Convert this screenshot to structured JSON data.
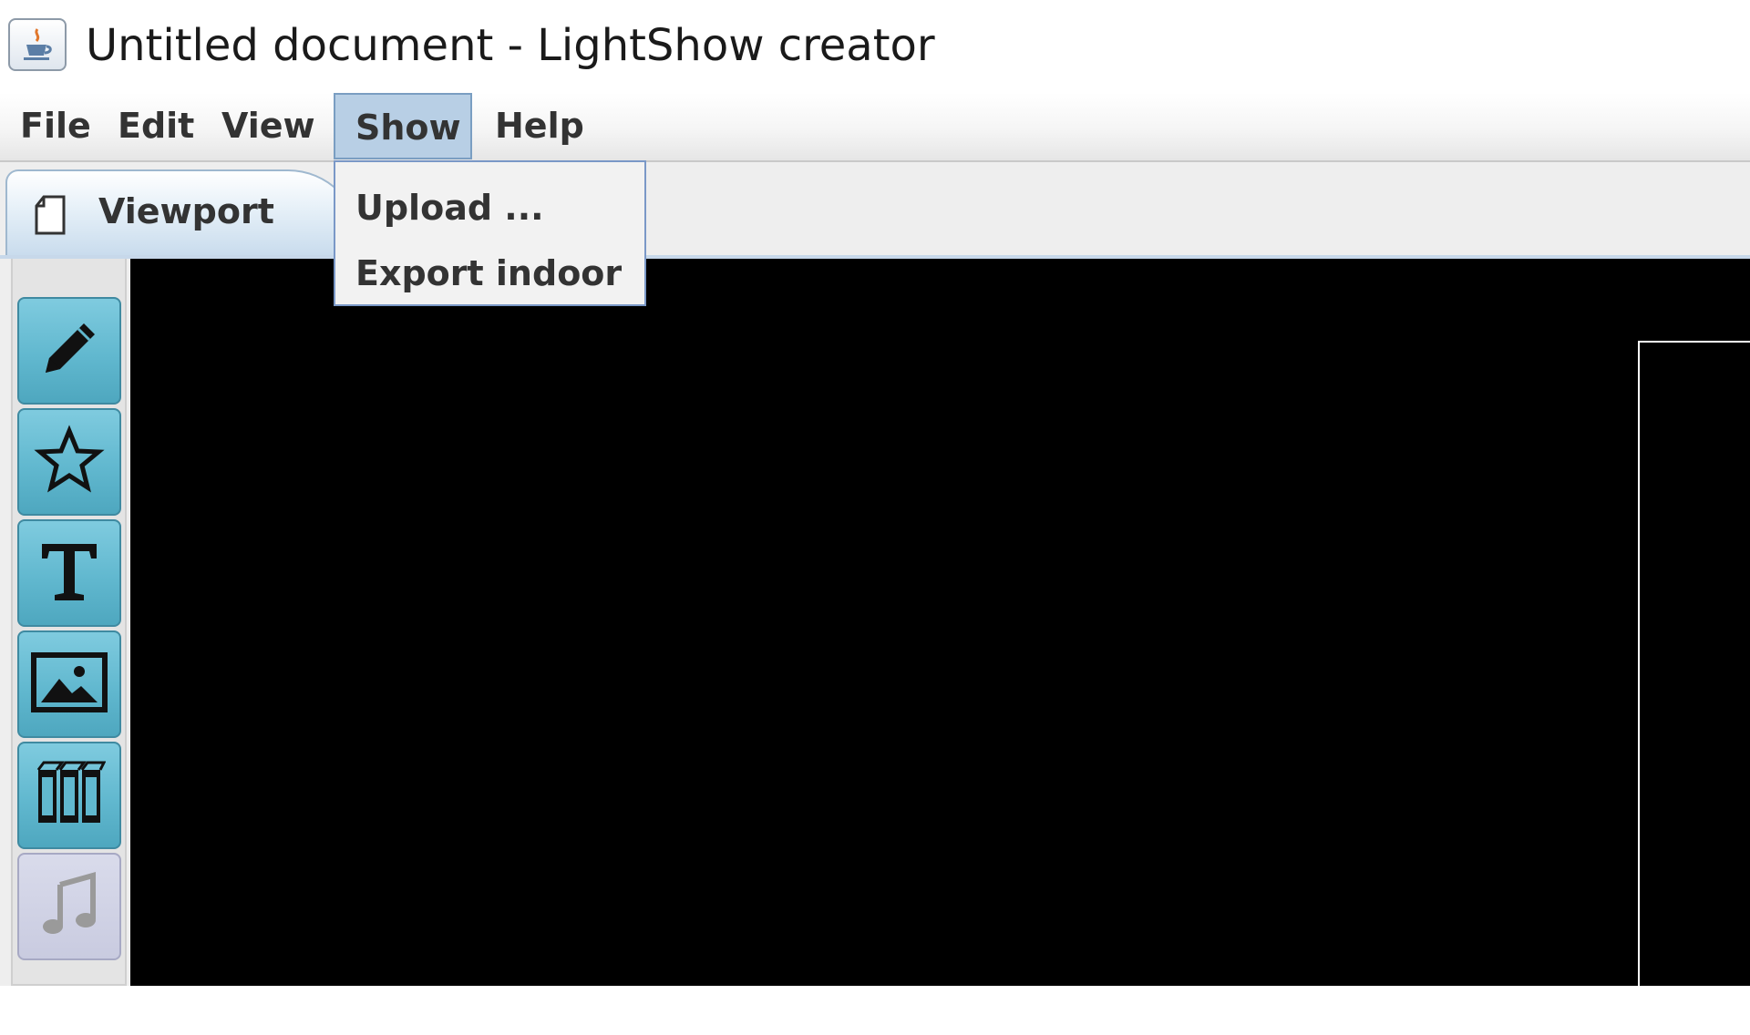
{
  "window": {
    "title": "Untitled document - LightShow creator",
    "icon": "java-coffee-cup-icon"
  },
  "menubar": {
    "items": [
      {
        "label": "File"
      },
      {
        "label": "Edit"
      },
      {
        "label": "View"
      },
      {
        "label": "Show",
        "active": true
      },
      {
        "label": "Help"
      }
    ]
  },
  "show_menu": {
    "items": [
      {
        "label": "Upload ..."
      },
      {
        "label": "Export indoor"
      }
    ]
  },
  "tabs": [
    {
      "label": "Viewport",
      "icon": "document-icon"
    }
  ],
  "toolbar": {
    "tools": [
      {
        "icon": "pencil-icon",
        "enabled": true
      },
      {
        "icon": "star-icon",
        "enabled": true
      },
      {
        "icon": "text-icon",
        "enabled": true
      },
      {
        "icon": "image-icon",
        "enabled": true
      },
      {
        "icon": "film-strip-icon",
        "enabled": true
      },
      {
        "icon": "music-note-icon",
        "enabled": false
      }
    ]
  },
  "colors": {
    "tool_button": "#61b8cf",
    "tool_button_disabled": "#c9cbe0",
    "menu_active": "#b8cfe5",
    "canvas": "#000000"
  }
}
